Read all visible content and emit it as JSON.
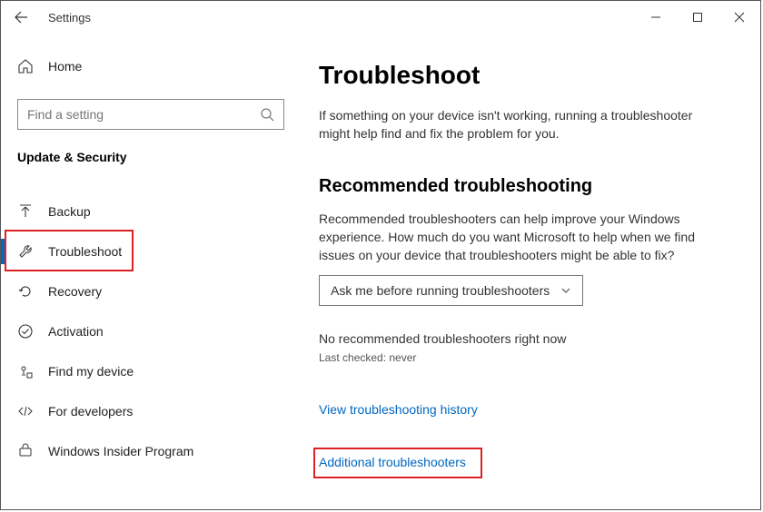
{
  "titlebar": {
    "title": "Settings"
  },
  "sidebar": {
    "home_label": "Home",
    "search_placeholder": "Find a setting",
    "section_header": "Update & Security",
    "items": [
      {
        "icon": "backup-icon",
        "label": "Backup"
      },
      {
        "icon": "wrench-icon",
        "label": "Troubleshoot",
        "selected": true,
        "redbox": true
      },
      {
        "icon": "recovery-icon",
        "label": "Recovery"
      },
      {
        "icon": "check-circle-icon",
        "label": "Activation"
      },
      {
        "icon": "find-device-icon",
        "label": "Find my device"
      },
      {
        "icon": "developers-icon",
        "label": "For developers"
      },
      {
        "icon": "insider-icon",
        "label": "Windows Insider Program"
      }
    ]
  },
  "main": {
    "title": "Troubleshoot",
    "intro": "If something on your device isn't working, running a troubleshooter might help find and fix the problem for you.",
    "section_title": "Recommended troubleshooting",
    "section_body": "Recommended troubleshooters can help improve your Windows experience. How much do you want Microsoft to help when we find issues on your device that troubleshooters might be able to fix?",
    "dropdown_value": "Ask me before running troubleshooters",
    "status_line": "No recommended troubleshooters right now",
    "last_checked": "Last checked: never",
    "link_history": "View troubleshooting history",
    "link_additional": "Additional troubleshooters"
  }
}
